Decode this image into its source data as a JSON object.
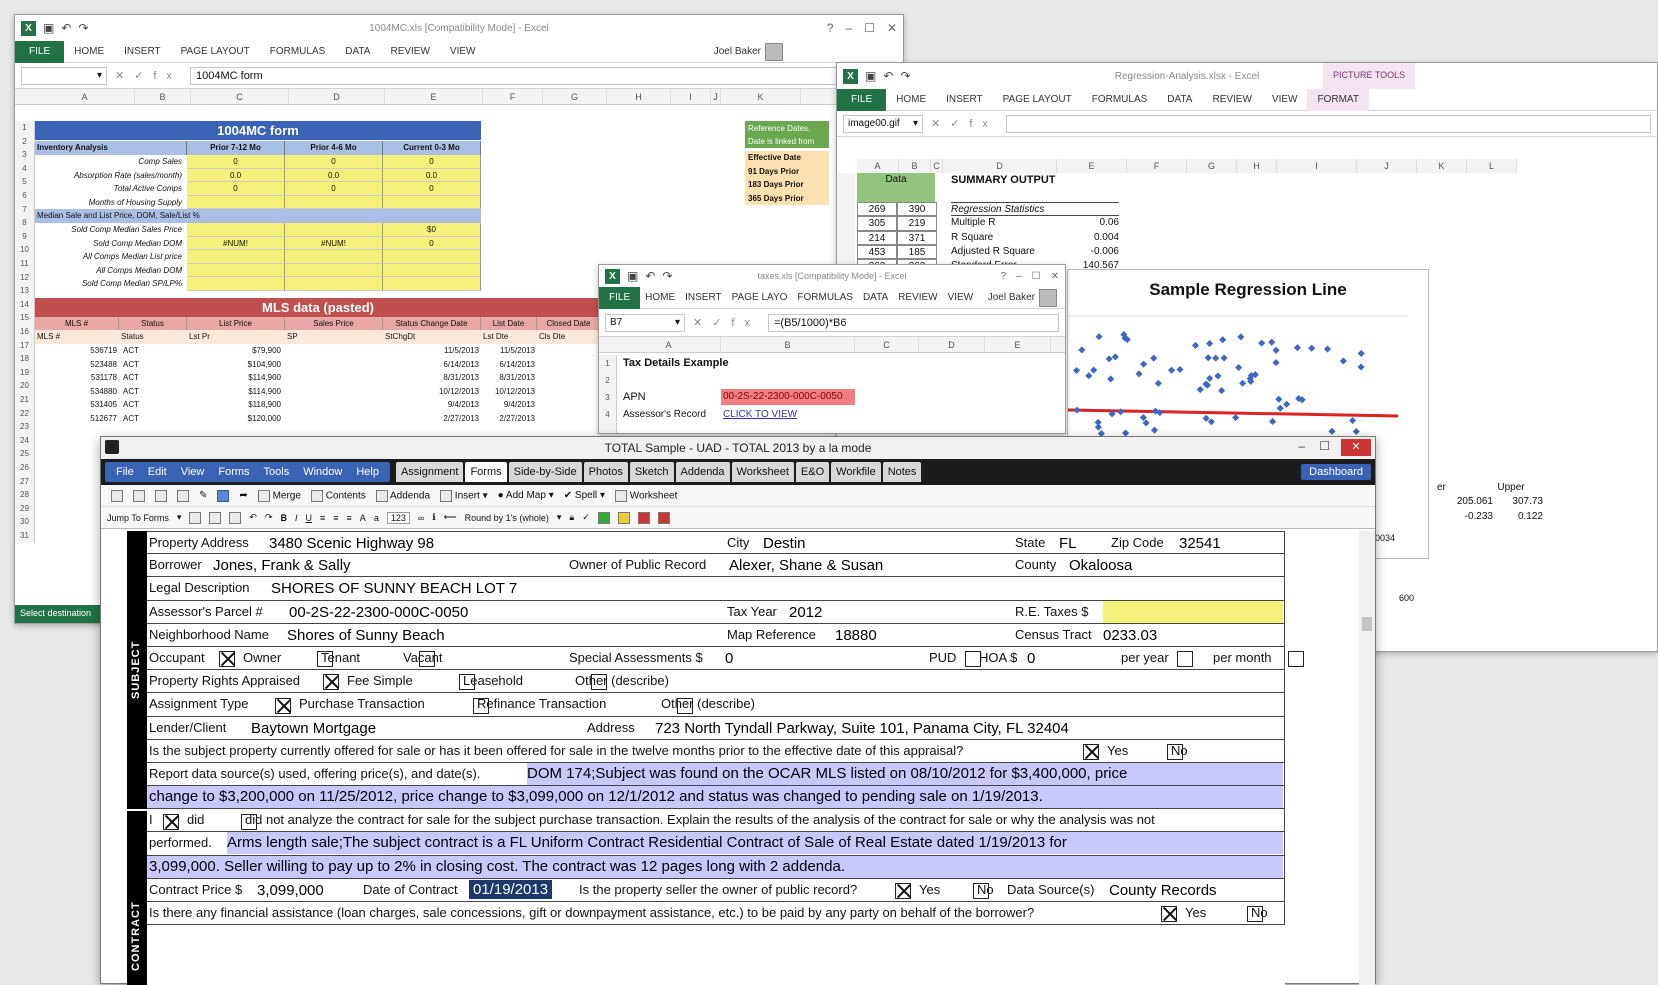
{
  "xl1": {
    "title": "1004MC.xls [Compatibility Mode] - Excel",
    "tabs": [
      "FILE",
      "HOME",
      "INSERT",
      "PAGE LAYOUT",
      "FORMULAS",
      "DATA",
      "REVIEW",
      "VIEW"
    ],
    "user": "Joel Baker",
    "formula": "1004MC form",
    "cols": [
      "A",
      "B",
      "C",
      "D",
      "E",
      "F",
      "G",
      "H",
      "I",
      "J",
      "K"
    ],
    "rows": [
      "1",
      "2",
      "3",
      "4",
      "5",
      "6",
      "7",
      "8",
      "9",
      "10",
      "11",
      "12",
      "13",
      "14",
      "15",
      "16",
      "17",
      "18",
      "19",
      "20",
      "21",
      "22",
      "23",
      "24",
      "25",
      "26",
      "27",
      "28",
      "29",
      "30",
      "31"
    ],
    "sheet_title": "1004MC form",
    "headers": [
      "Inventory Analysis",
      "Prior 7-12 Mo",
      "Prior 4-6 Mo",
      "Current 0-3 Mo"
    ],
    "inv_rows": [
      {
        "label": "Comp Sales",
        "v": [
          "0",
          "0",
          "0"
        ]
      },
      {
        "label": "Absorption Rate (sales/month)",
        "v": [
          "0.0",
          "0.0",
          "0.0"
        ]
      },
      {
        "label": "Total Active Comps",
        "v": [
          "0",
          "0",
          "0"
        ]
      },
      {
        "label": "Months of Housing Supply",
        "v": [
          "",
          "",
          ""
        ]
      }
    ],
    "median_header": "Median Sale and List Price, DOM, Sale/List %",
    "median_rows": [
      {
        "label": "Sold Comp Median Sales Price",
        "v": [
          "",
          "",
          "$0"
        ]
      },
      {
        "label": "Sold Comp Median DOM",
        "v": [
          "#NUM!",
          "#NUM!",
          "0"
        ]
      },
      {
        "label": "All Comps Median List price",
        "v": [
          "",
          "",
          ""
        ]
      },
      {
        "label": "All Comps Median DOM",
        "v": [
          "",
          "",
          ""
        ]
      },
      {
        "label": "Sold Comp Median SP/LP%",
        "v": [
          "",
          "",
          ""
        ]
      }
    ],
    "mls_title": "MLS data (pasted)",
    "mls_cols": [
      "MLS #",
      "Status",
      "List Price",
      "Sales Price",
      "Status Change Date",
      "List Date",
      "Closed Date"
    ],
    "mls_sub": [
      "MLS #",
      "Status",
      "Lst Pr",
      "SP",
      "StChgDt",
      "Lst Dte",
      "Cls Dte"
    ],
    "mls_rows": [
      [
        "536719",
        "ACT",
        "$79,900",
        "",
        "11/5/2013",
        "11/5/2013"
      ],
      [
        "523488",
        "ACT",
        "$104,900",
        "",
        "6/14/2013",
        "6/14/2013"
      ],
      [
        "531178",
        "ACT",
        "$114,900",
        "",
        "8/31/2013",
        "8/31/2013"
      ],
      [
        "534880",
        "ACT",
        "$114,900",
        "",
        "10/12/2013",
        "10/12/2013"
      ],
      [
        "531405",
        "ACT",
        "$118,900",
        "",
        "9/4/2013",
        "9/4/2013"
      ],
      [
        "512677",
        "ACT",
        "$120,000",
        "",
        "2/27/2013",
        "2/27/2013"
      ]
    ],
    "ref_text": "Reference Dates. Date is linked from",
    "ref_rows": [
      "Effective Date",
      "91 Days Prior",
      "183 Days Prior",
      "365 Days Prior"
    ],
    "status": "Select destination"
  },
  "xl2": {
    "title": "Regression-Analysis.xlsx - Excel",
    "tools": "PICTURE TOOLS",
    "tabs": [
      "FILE",
      "HOME",
      "INSERT",
      "PAGE LAYOUT",
      "FORMULAS",
      "DATA",
      "REVIEW",
      "VIEW",
      "FORMAT"
    ],
    "namebox": "image00.gif",
    "cols": [
      "A",
      "B",
      "C",
      "D",
      "E",
      "F",
      "G",
      "H",
      "I",
      "J",
      "K",
      "L"
    ],
    "data_hdr": "Data",
    "data": [
      [
        "269",
        "390"
      ],
      [
        "305",
        "219"
      ],
      [
        "214",
        "371"
      ],
      [
        "453",
        "185"
      ],
      [
        "262",
        "262"
      ]
    ],
    "summary": "SUMMARY OUTPUT",
    "reg": "Regression Statistics",
    "stats": [
      [
        "Multiple R",
        "0.06"
      ],
      [
        "R Square",
        "0.004"
      ],
      [
        "Adjusted R Square",
        "-0.006"
      ],
      [
        "Standard Error",
        "140.567"
      ]
    ],
    "chart_title": "Sample Regression Line",
    "upper_hdr": [
      "er",
      "Upper"
    ],
    "upper": [
      [
        "205.061",
        "307.73"
      ],
      [
        "-0.233",
        "0.122"
      ]
    ],
    "axis_val": "600",
    "misc": "0034"
  },
  "xl3": {
    "title": "taxes.xls [Compatibility Mode] - Excel",
    "tabs": [
      "FILE",
      "HOME",
      "INSERT",
      "PAGE LAYO",
      "FORMULAS",
      "DATA",
      "REVIEW",
      "VIEW"
    ],
    "user": "Joel Baker",
    "namebox": "B7",
    "formula": "=(B5/1000)*B6",
    "cols": [
      "A",
      "B",
      "C",
      "D",
      "E"
    ],
    "title_cell": "Tax Details Example",
    "apn_label": "APN",
    "apn": "00-2S-22-2300-000C-0050",
    "assessor": "Assessor's Record",
    "link": "CLICK TO VIEW"
  },
  "uad": {
    "title": "TOTAL Sample - UAD - TOTAL 2013 by a la mode",
    "menu": [
      "File",
      "Edit",
      "View",
      "Forms",
      "Tools",
      "Window",
      "Help"
    ],
    "tabs": [
      "Assignment",
      "Forms",
      "Side-by-Side",
      "Photos",
      "Sketch",
      "Addenda",
      "Worksheet",
      "E&O",
      "Workfile",
      "Notes"
    ],
    "dashboard": "Dashboard",
    "tool1": [
      "Merge",
      "Contents",
      "Addenda",
      "Insert",
      "Add Map",
      "Spell",
      "Worksheet"
    ],
    "jump": "Jump To Forms",
    "round": "Round by 1's (whole)",
    "zoom": "123",
    "sections": [
      "SUBJECT",
      "CONTRACT"
    ],
    "f": {
      "prop_addr_l": "Property Address",
      "prop_addr": "3480 Scenic Highway 98",
      "city_l": "City",
      "city": "Destin",
      "state_l": "State",
      "state": "FL",
      "zip_l": "Zip Code",
      "zip": "32541",
      "borrower_l": "Borrower",
      "borrower": "Jones, Frank & Sally",
      "owner_l": "Owner of Public Record",
      "owner": "Alexer, Shane & Susan",
      "county_l": "County",
      "county": "Okaloosa",
      "legal_l": "Legal Description",
      "legal": "SHORES OF SUNNY BEACH LOT 7",
      "parcel_l": "Assessor's Parcel #",
      "parcel": "00-2S-22-2300-000C-0050",
      "taxyear_l": "Tax Year",
      "taxyear": "2012",
      "retax_l": "R.E. Taxes $",
      "nbhd_l": "Neighborhood Name",
      "nbhd": "Shores of Sunny Beach",
      "mapref_l": "Map Reference",
      "mapref": "18880",
      "census_l": "Census Tract",
      "census": "0233.03",
      "occupant_l": "Occupant",
      "owner_o": "Owner",
      "tenant": "Tenant",
      "vacant": "Vacant",
      "spec_l": "Special Assessments $",
      "spec": "0",
      "pud": "PUD",
      "hoa_l": "HOA $",
      "hoa": "0",
      "peryear": "per year",
      "permonth": "per month",
      "rights_l": "Property Rights Appraised",
      "fee": "Fee Simple",
      "lease": "Leasehold",
      "other": "Other (describe)",
      "assign_l": "Assignment Type",
      "purchase": "Purchase Transaction",
      "refi": "Refinance Transaction",
      "other2": "Other (describe)",
      "lender_l": "Lender/Client",
      "lender": "Baytown Mortgage",
      "addr_l": "Address",
      "addr": "723 North Tyndall Parkway, Suite 101, Panama City, FL 32404",
      "offered_q": "Is the subject property currently offered for sale or has it been offered for sale in the twelve months prior to the effective date of this appraisal?",
      "yes": "Yes",
      "no": "No",
      "report_l": "Report data source(s) used, offering price(s), and date(s).",
      "report1": "DOM 174;Subject was found on the OCAR MLS listed on 08/10/2012 for $3,400,000, price",
      "report2": "change to $3,200,000 on 11/25/2012, price change to $3,099,000 on 12/1/2012 and status was changed to pending sale on 1/19/2013.",
      "i": "I",
      "did": "did",
      "didnot": "did not analyze the contract for sale for the subject purchase transaction. Explain the results of the analysis of the contract for sale or why the analysis was not",
      "performed": "performed.",
      "contract1": "Arms length sale;The subject contract is a FL Uniform Contract Residential Contract of Sale of Real Estate dated 1/19/2013 for",
      "contract2": "3,099,000. Seller willing to pay up to 2% in closing cost. The contract was 12 pages long with 2 addenda.",
      "cprice_l": "Contract Price $",
      "cprice": "3,099,000",
      "cdate_l": "Date of Contract",
      "cdate": "01/19/2013",
      "seller_q": "Is the property seller the owner of public record?",
      "source_l": "Data Source(s)",
      "source": "County Records",
      "fin_q": "Is there any financial assistance (loan charges, sale concessions, gift or downpayment assistance, etc.) to be paid by any party on behalf of the borrower?"
    }
  }
}
